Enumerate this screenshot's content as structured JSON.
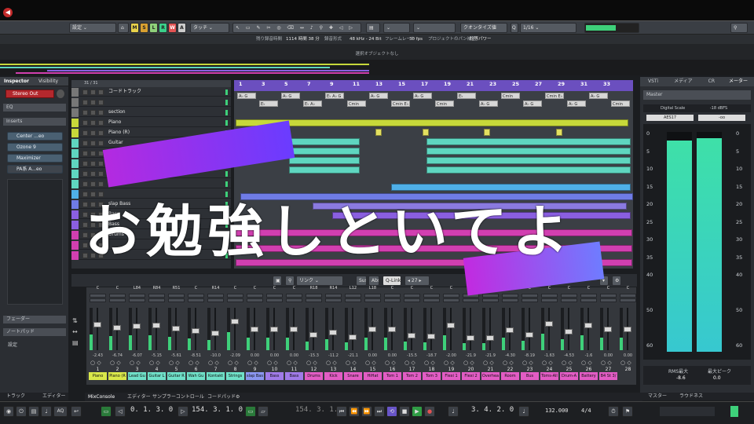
{
  "toolbar": {
    "preset": "設定",
    "mode_buttons": [
      "M",
      "S",
      "L",
      "R",
      "W",
      "A"
    ],
    "automation_mode": "タッチ",
    "snap_type": "クオンタイズ値",
    "quantize": "1/16",
    "zoom_q": "Q"
  },
  "infobar": {
    "record_time_label": "残り録音時間",
    "record_time": "1114 時間 38 分",
    "record_format_label": "録音形式",
    "record_format": "48 kHz - 24 Bit",
    "frame_rate_label": "フレームレート",
    "frame_rate": "30 fps",
    "pan_label": "プロジェクトのパン補正",
    "pan_value": "均等パワー"
  },
  "status": "選択オブジェクトなし",
  "inspector": {
    "tabs": [
      "Inspector",
      "Visibility"
    ],
    "output": "Stereo Out",
    "eq": "EQ",
    "inserts": "Inserts",
    "plugins": [
      "Center ...eo",
      "Ozone 9",
      "Maximizer",
      "PA系 A...eo"
    ],
    "fader": "フェーダー",
    "notepad": "ノートパッド",
    "settings": "設定",
    "bottom_tabs": [
      "トラック",
      "エディター"
    ]
  },
  "tracklist": {
    "header_count": "31 / 31",
    "rows": [
      {
        "name": "コードトラック",
        "color": "#777"
      },
      {
        "name": "",
        "color": "#777"
      },
      {
        "name": "section",
        "color": "#777"
      },
      {
        "name": "Piano",
        "color": "#c7d83a"
      },
      {
        "name": "Piano (R)",
        "color": "#c7d83a"
      },
      {
        "name": "Guitar",
        "color": "#5fd6c0"
      },
      {
        "name": "Lead Guitar",
        "color": "#5fd6c0"
      },
      {
        "name": "",
        "color": "#5fd6c0"
      },
      {
        "name": "",
        "color": "#5fd6c0"
      },
      {
        "name": "",
        "color": "#5fd6c0"
      },
      {
        "name": "",
        "color": "#4fb0e8"
      },
      {
        "name": "slap Bass",
        "color": "#6f7ce6"
      },
      {
        "name": "Bass",
        "color": "#8a5fe0"
      },
      {
        "name": "Bass",
        "color": "#8a5fe0"
      },
      {
        "name": "Drums",
        "color": "#d13fb0"
      },
      {
        "name": "",
        "color": "#d13fb0"
      },
      {
        "name": "",
        "color": "#d13fb0"
      }
    ],
    "chord_sub": "Chord monitor"
  },
  "ruler": {
    "bars": [
      "1",
      "3",
      "5",
      "7",
      "9",
      "11",
      "13",
      "15",
      "17",
      "19",
      "21",
      "23",
      "25",
      "27",
      "29",
      "31",
      "33"
    ]
  },
  "chords": [
    "A♭ G",
    "E♭",
    "A♭ G",
    "E♭ A♭",
    "E♭ A♭ G",
    "Cmin",
    "A♭ G",
    "Cmin E♭",
    "A♭ G",
    "Cmin",
    "E♭",
    "A♭ G",
    "Cmin",
    "A♭ G",
    "Cmin E♭",
    "A♭ G",
    "A♭ G",
    "Cmin"
  ],
  "mixer": {
    "toolbar": {
      "link": "リンク",
      "sus": "Sus",
      "abs": "Abs",
      "qlink": "Q-Link",
      "count": "27"
    },
    "pans": [
      "C",
      "C",
      "L84",
      "R84",
      "R51",
      "C",
      "R14",
      "C",
      "C",
      "C",
      "C",
      "R18",
      "R14",
      "L12",
      "L18",
      "C",
      "C",
      "C",
      "C",
      "C",
      "C",
      "C",
      "C",
      "C",
      "C",
      "C",
      "C",
      "C"
    ],
    "values": [
      "-2.43",
      "-6.74",
      "-6.07",
      "-5.15",
      "-5.61",
      "-8.51",
      "-10.0",
      "-2.09",
      "0.00",
      "0.00",
      "0.00",
      "-15.3",
      "-11.2",
      "-21.1",
      "0.00",
      "0.00",
      "-15.5",
      "-18.7",
      "-2.00",
      "-21.9",
      "-21.9",
      "-4.30",
      "-8.19",
      "-1.63",
      "-4.53",
      "-1.6",
      "0.00",
      "0.00"
    ],
    "numbers": [
      "1",
      "2",
      "3",
      "4",
      "5",
      "6",
      "7",
      "8",
      "9",
      "10",
      "11",
      "12",
      "13",
      "14",
      "15",
      "16",
      "17",
      "18",
      "19",
      "20",
      "21",
      "22",
      "23",
      "24",
      "25",
      "26",
      "27",
      "28"
    ],
    "names": [
      "Piano",
      "Piano (R",
      "Lead Gu",
      "Guitar L",
      "Guitar R",
      "Wah Gu",
      "Kontakt",
      "Strings",
      "slap Bas",
      "Bass",
      "Bass",
      "Drums",
      "Kick",
      "Snare",
      "HiHat",
      "Tom 1",
      "Tom 2",
      "Tom 3",
      "Flexi 1",
      "Flexi 2",
      "Overhea",
      "Room",
      "Bus",
      "Toms-All",
      "Drum-A",
      "Battery",
      "B4 St 3/"
    ],
    "name_colors": [
      "#d9e84a",
      "#d9e84a",
      "#6fe0c8",
      "#6fe0c8",
      "#6fe0c8",
      "#6fe0c8",
      "#6fe0c8",
      "#6fe0c8",
      "#8a96f0",
      "#a07ae8",
      "#a07ae8",
      "#e25cc4",
      "#e25cc4",
      "#e25cc4",
      "#e25cc4",
      "#e25cc4",
      "#e25cc4",
      "#e25cc4",
      "#e25cc4",
      "#e25cc4",
      "#e25cc4",
      "#e25cc4",
      "#e25cc4",
      "#e25cc4",
      "#e25cc4",
      "#e25cc4",
      "#e25cc4"
    ],
    "fader_levels": [
      0.62,
      0.55,
      0.58,
      0.6,
      0.52,
      0.45,
      0.4,
      0.7,
      0.5,
      0.5,
      0.5,
      0.35,
      0.42,
      0.3,
      0.5,
      0.5,
      0.33,
      0.31,
      0.6,
      0.28,
      0.28,
      0.48,
      0.36,
      0.65,
      0.44,
      0.6,
      0.5,
      0.5
    ]
  },
  "right": {
    "tabs": [
      "VSTi",
      "メディア",
      "CR",
      "メーター"
    ],
    "master": "Master",
    "scale_label": "Digital Scale",
    "scale_value": "-18 dBFS",
    "aes": "AES17",
    "inf": "-oo",
    "ticks": [
      "0",
      "5",
      "10",
      "15",
      "20",
      "25",
      "30",
      "35",
      "40",
      "50",
      "60"
    ],
    "rms_label": "RMS最大",
    "rms_value": "-8.6",
    "peak_label": "最大ピーク",
    "peak_value": "0.0",
    "bottom_tabs": [
      "マスター",
      "ラウドネス"
    ],
    "meter_levels": [
      0.96,
      0.97
    ]
  },
  "lower_tabs": [
    "MixConsole",
    "エディター",
    "サンプラーコントロール",
    "コードパッド"
  ],
  "transport": {
    "left_locator": "0. 1. 3. 0",
    "right_locator": "154. 3. 1. 0",
    "punch_pos": "154. 3. 1. 0",
    "position": "3. 4. 2. 0",
    "tempo": "132.000",
    "signature": "4/4",
    "aq": "AQ"
  },
  "overlay": {
    "text": "お勉強しといてよ"
  }
}
